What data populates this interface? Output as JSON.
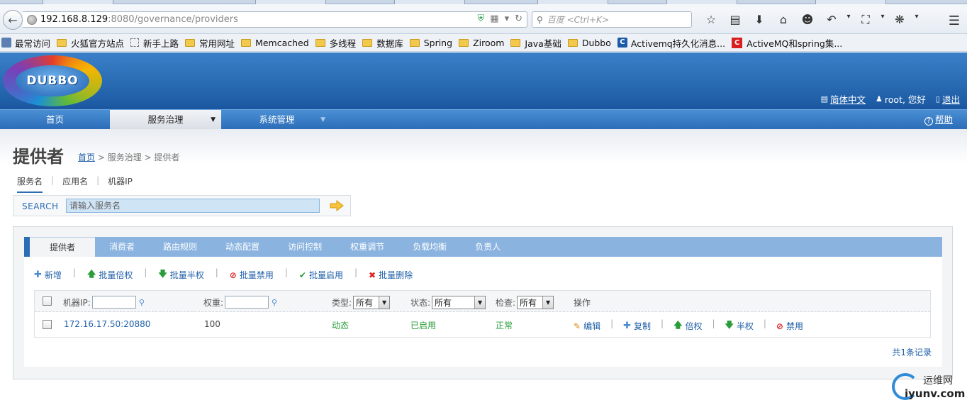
{
  "browser": {
    "url_host": "192.168.8.129",
    "url_path": ":8080/governance/providers",
    "search_placeholder": "百度 <Ctrl+K>",
    "bookmarks": [
      "最常访问",
      "火狐官方站点",
      "新手上路",
      "常用网址",
      "Memcached",
      "多线程",
      "数据库",
      "Spring",
      "Ziroom",
      "Java基础",
      "Dubbo",
      "Activemq持久化消息...",
      "ActiveMQ和spring集..."
    ]
  },
  "header": {
    "logo_text": "DUBBO",
    "language": "简体中文",
    "greeting": "root, 您好",
    "logout": "退出"
  },
  "nav": {
    "home": "首页",
    "service_gov": "服务治理",
    "system_mgmt": "系统管理",
    "help": "帮助"
  },
  "page": {
    "title": "提供者",
    "breadcrumb_home": "首页",
    "breadcrumb_rest": " > 服务治理 > 提供者"
  },
  "search": {
    "tabs": [
      "服务名",
      "应用名",
      "机器IP"
    ],
    "label": "SEARCH",
    "placeholder": "请输入服务名"
  },
  "panel": {
    "tabs": [
      "提供者",
      "消费者",
      "路由规则",
      "动态配置",
      "访问控制",
      "权重调节",
      "负载均衡",
      "负责人"
    ],
    "actions": [
      "新增",
      "批量倍权",
      "批量半权",
      "批量禁用",
      "批量启用",
      "批量删除"
    ],
    "header": {
      "ip_label": "机器IP:",
      "weight_label": "权重:",
      "type_label": "类型:",
      "type_value": "所有",
      "status_label": "状态:",
      "status_value": "所有",
      "check_label": "检查:",
      "check_value": "所有",
      "ops_label": "操作"
    },
    "rows": [
      {
        "address": "172.16.17.50:20880",
        "weight": "100",
        "type": "动态",
        "status": "已启用",
        "check": "正常",
        "ops": [
          "编辑",
          "复制",
          "倍权",
          "半权",
          "禁用"
        ]
      }
    ],
    "total": "共1条记录"
  },
  "watermark": {
    "top": "运维网",
    "bottom": "iyunv.com"
  }
}
